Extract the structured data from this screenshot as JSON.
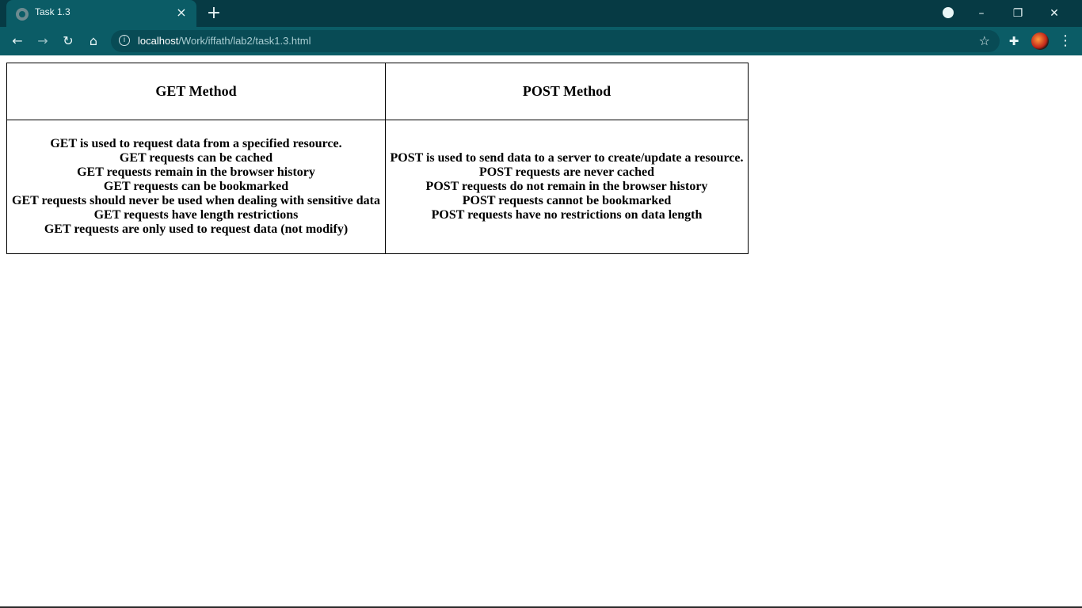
{
  "browser": {
    "tab_title": "Task 1.3",
    "tab_close": "×",
    "new_tab": "+",
    "url_host": "localhost",
    "url_path": "/Work/iffath/lab2/task1.3.html",
    "controls": {
      "minimize": "–",
      "restore": "❐",
      "close": "✕"
    }
  },
  "table": {
    "headers": [
      "GET Method",
      "POST Method"
    ],
    "get_items": [
      "GET is used to request data from a specified resource.",
      "GET requests can be cached",
      "GET requests remain in the browser history",
      "GET requests can be bookmarked",
      "GET requests should never be used when dealing with sensitive data",
      "GET requests have length restrictions",
      "GET requests are only used to request data (not modify)"
    ],
    "post_items": [
      "POST is used to send data to a server to create/update a resource.",
      "POST requests are never cached",
      "POST requests do not remain in the browser history",
      "POST requests cannot be bookmarked",
      "POST requests have no restrictions on data length"
    ]
  }
}
